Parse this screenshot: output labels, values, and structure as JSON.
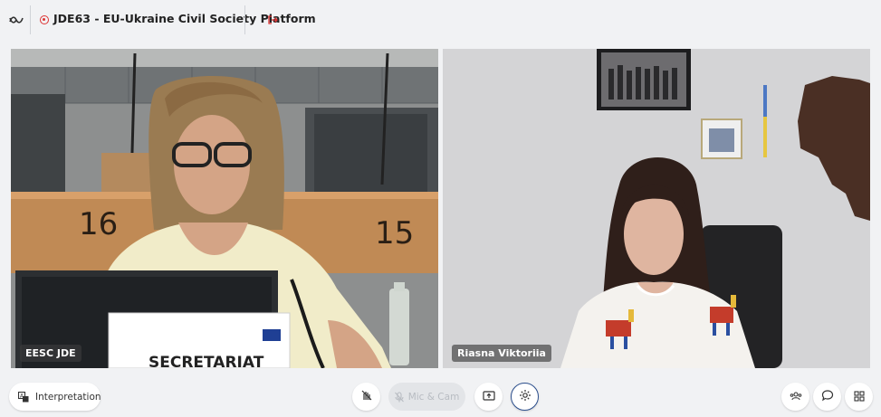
{
  "header": {
    "title": "JDE63 - EU-Ukraine Civil Society Platform",
    "recording": true
  },
  "tiles": [
    {
      "name": "EESC JDE",
      "scene": {
        "desk_numbers": [
          "16",
          "15"
        ],
        "nameplate": "SECRETARIAT"
      }
    },
    {
      "name": "Riasna Viktoriia"
    }
  ],
  "toolbar": {
    "interpretation_label": "Interpretation",
    "mic_cam_label": "Mic & Cam"
  },
  "colors": {
    "background": "#f1f2f4",
    "recording": "#dd3333",
    "settings_ring": "#2c4f8d"
  }
}
